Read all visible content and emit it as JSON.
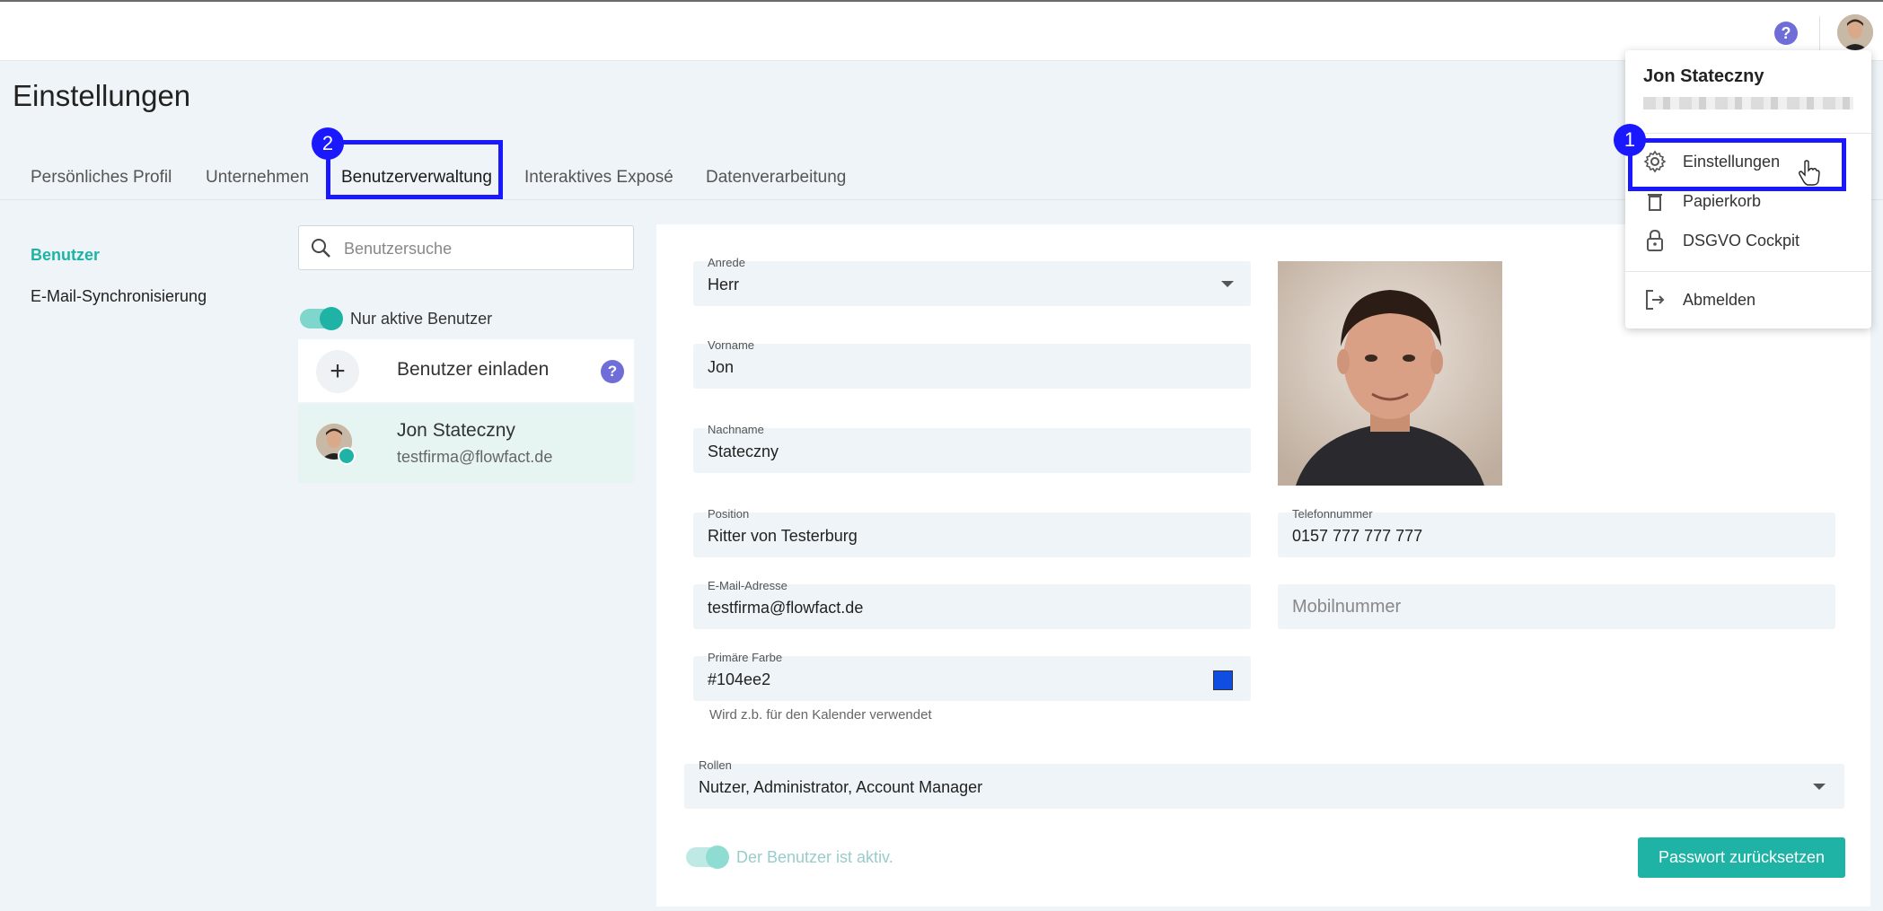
{
  "header": {
    "help_symbol": "?"
  },
  "page": {
    "title": "Einstellungen"
  },
  "tabs": [
    {
      "label": "Persönliches Profil"
    },
    {
      "label": "Unternehmen"
    },
    {
      "label": "Benutzerverwaltung"
    },
    {
      "label": "Interaktives Exposé"
    },
    {
      "label": "Datenverarbeitung"
    }
  ],
  "annotations": {
    "badge_1": "1",
    "badge_2": "2"
  },
  "sidenav": {
    "items": [
      {
        "label": "Benutzer"
      },
      {
        "label": "E-Mail-Synchronisierung"
      }
    ]
  },
  "user_list": {
    "search_placeholder": "Benutzersuche",
    "active_only_label": "Nur aktive Benutzer",
    "invite_label": "Benutzer einladen",
    "invite_help": "?",
    "users": [
      {
        "name": "Jon Stateczny",
        "email": "testfirma@flowfact.de"
      }
    ]
  },
  "form": {
    "anrede": {
      "label": "Anrede",
      "value": "Herr"
    },
    "vorname": {
      "label": "Vorname",
      "value": "Jon"
    },
    "nachname": {
      "label": "Nachname",
      "value": "Stateczny"
    },
    "position": {
      "label": "Position",
      "value": "Ritter von Testerburg"
    },
    "telefon": {
      "label": "Telefonnummer",
      "value": "0157 777 777 777"
    },
    "email": {
      "label": "E-Mail-Adresse",
      "value": "testfirma@flowfact.de"
    },
    "mobil": {
      "placeholder": "Mobilnummer"
    },
    "farbe": {
      "label": "Primäre Farbe",
      "value": "#104ee2",
      "hint": "Wird z.b. für den Kalender verwendet"
    },
    "rollen": {
      "label": "Rollen",
      "value": "Nutzer, Administrator, Account Manager"
    },
    "active_label": "Der Benutzer ist aktiv.",
    "reset_button": "Passwort zurücksetzen"
  },
  "user_menu": {
    "name": "Jon Stateczny",
    "items": [
      {
        "label": "Einstellungen",
        "icon": "gear-icon"
      },
      {
        "label": "Papierkorb",
        "icon": "trash-icon"
      },
      {
        "label": "DSGVO Cockpit",
        "icon": "lock-icon"
      },
      {
        "label": "Abmelden",
        "icon": "logout-icon"
      }
    ]
  },
  "colors": {
    "accent": "#1fb3a5",
    "annotation": "#1a18ff",
    "help": "#6f6ed8",
    "primary_color": "#104ee2"
  }
}
